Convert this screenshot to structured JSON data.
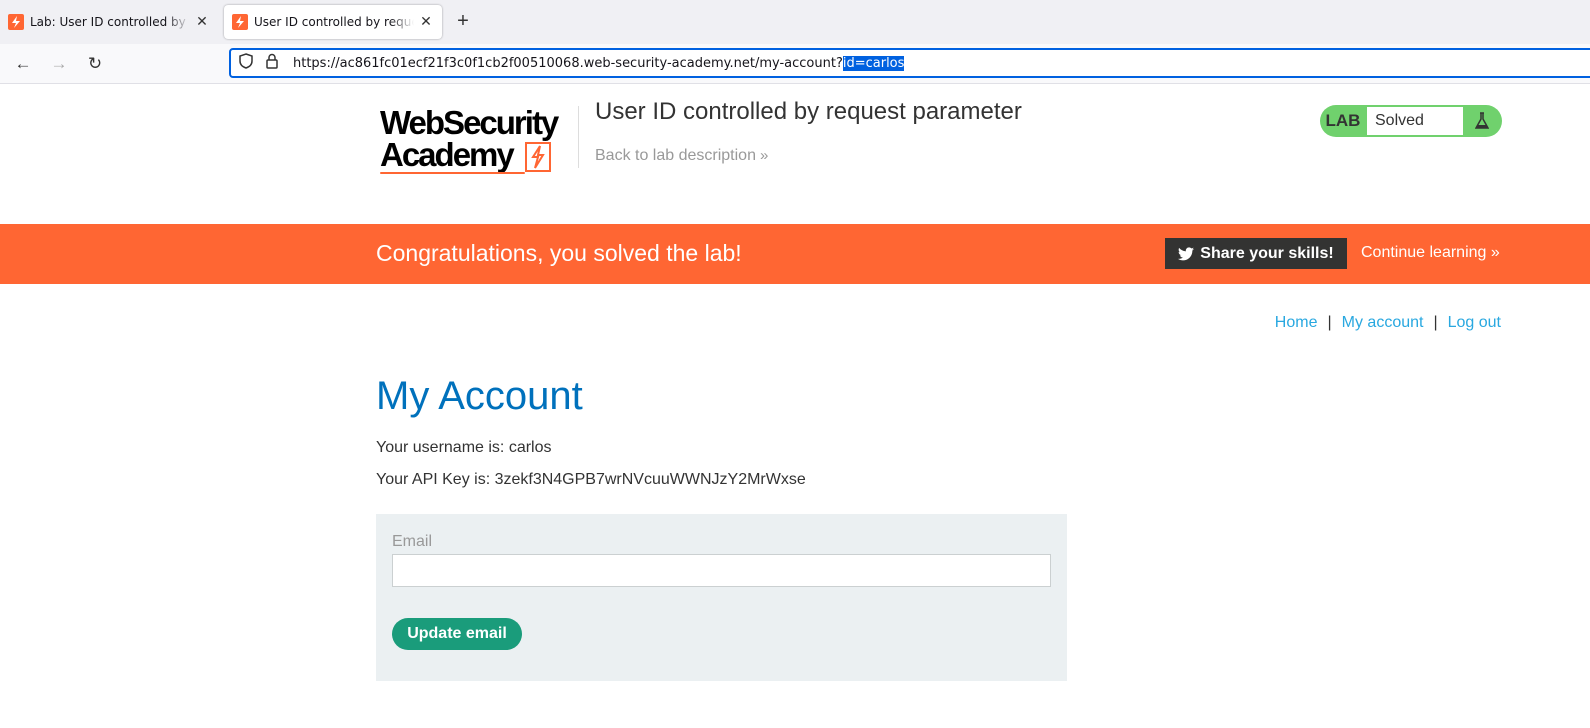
{
  "browser": {
    "tabs": [
      {
        "title": "Lab: User ID controlled by request parameter",
        "active": false
      },
      {
        "title": "User ID controlled by request parameter",
        "active": true
      }
    ],
    "url_main": "https://ac861fc01ecf21f3c0f1cb2f00510068.web-security-academy.net/my-account?",
    "url_selected": "id=carlos"
  },
  "header": {
    "logo_line1": "WebSecurity",
    "logo_line2": "Academy",
    "lab_title": "User ID controlled by request parameter",
    "back_link": "Back to lab description",
    "badge_label": "LAB",
    "badge_status": "Solved"
  },
  "banner": {
    "message": "Congratulations, you solved the lab!",
    "share_label": "Share your skills!",
    "continue_label": "Continue learning"
  },
  "nav": {
    "home": "Home",
    "my_account": "My account",
    "log_out": "Log out",
    "separator": "|"
  },
  "account": {
    "heading": "My Account",
    "username_line": "Your username is: carlos",
    "api_key_line": "Your API Key is: 3zekf3N4GPB7wrNVcuuWWNJzY2MrWxse",
    "email_label": "Email",
    "email_value": "",
    "update_button": "Update email"
  },
  "colors": {
    "brand_orange": "#ff6633",
    "heading_blue": "#0071bc",
    "link_blue": "#29a8e0",
    "solved_green": "#70d16d",
    "button_teal": "#1a9c7b"
  }
}
